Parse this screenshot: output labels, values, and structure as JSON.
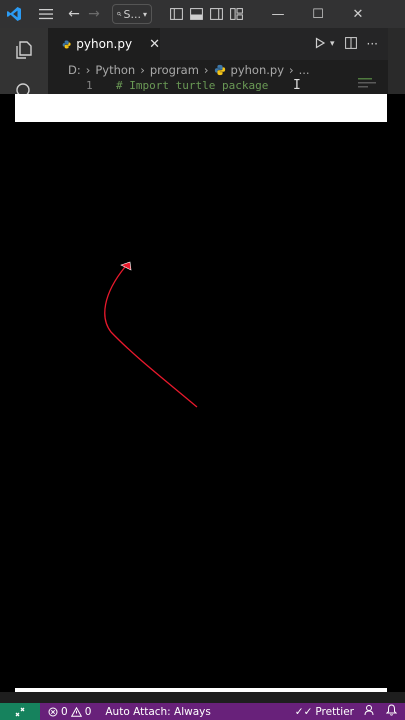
{
  "titlebar": {
    "search_label": "S..."
  },
  "editor": {
    "tab_label": "pyhon.py",
    "breadcrumb": [
      "D:",
      "Python",
      "program",
      "pyhon.py",
      "..."
    ],
    "line_number": "1",
    "code_line": "# Import turtle package"
  },
  "statusbar": {
    "errors": "0",
    "warnings": "0",
    "auto_attach": "Auto Attach: Always",
    "prettier": "Prettier"
  },
  "turtle": {
    "pen_color": "#e8192c"
  },
  "colors": {
    "titlebar_bg": "#323233",
    "statusbar_bg": "#68217a",
    "remote_bg": "#16825d",
    "vscode_blue": "#2b9bf4"
  }
}
